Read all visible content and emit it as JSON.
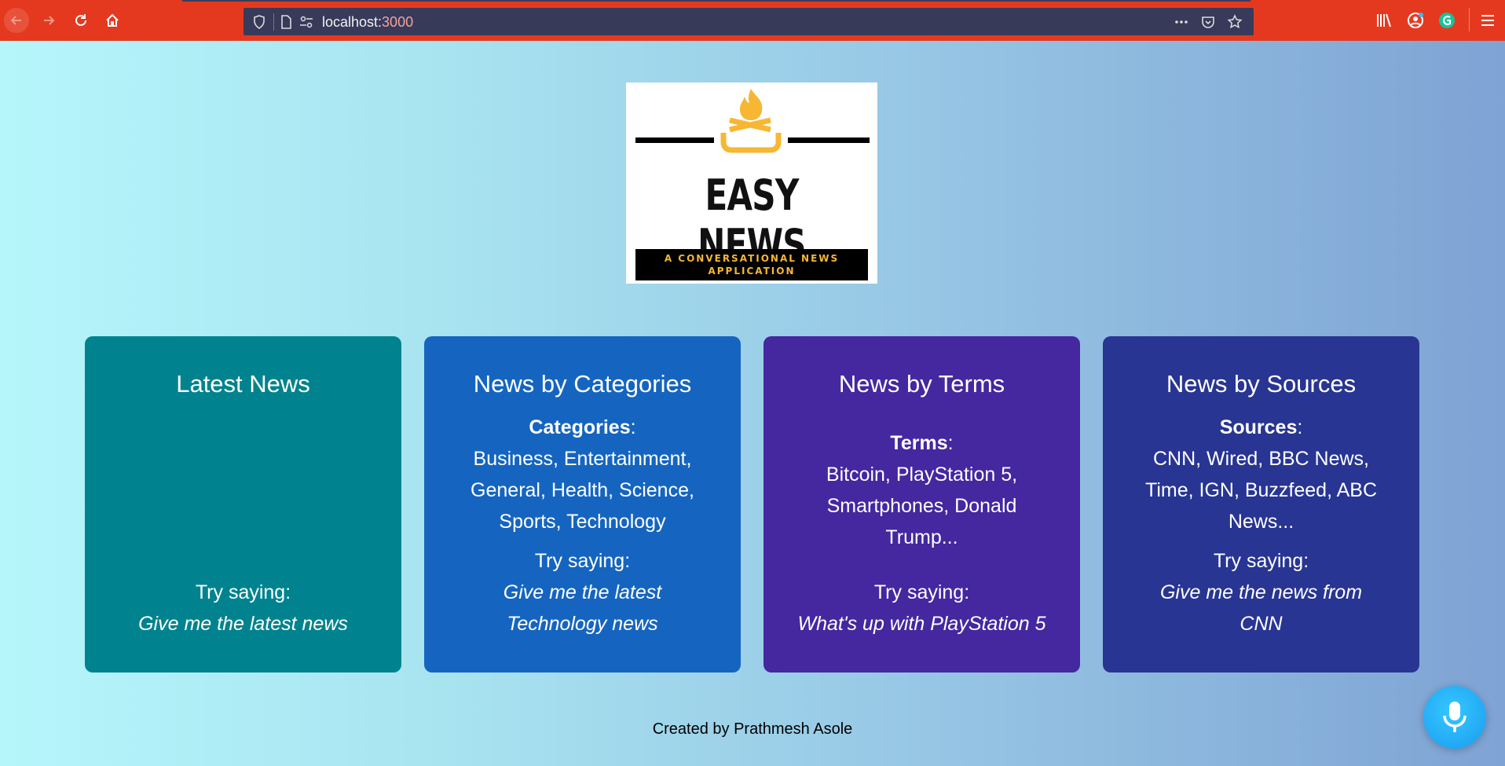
{
  "browser": {
    "url_host": "localhost:",
    "url_port": "3000"
  },
  "logo": {
    "title": "EASY NEWS",
    "subtitle": "A CONVERSATIONAL NEWS APPLICATION"
  },
  "cards": [
    {
      "title": "Latest News",
      "try_label": "Try saying:",
      "try_phrase": "Give me the latest news",
      "color": "#00838f"
    },
    {
      "title": "News by Categories",
      "info_label": "Categories",
      "info_colon": ":",
      "info_text": "Business, Entertainment, General, Health, Science, Sports, Technology",
      "try_label": "Try saying:",
      "try_phrase": "Give me the latest Technology news",
      "color": "#1565c0"
    },
    {
      "title": "News by Terms",
      "info_label": "Terms",
      "info_colon": ":",
      "info_text": "Bitcoin, PlayStation 5, Smartphones, Donald Trump...",
      "try_label": "Try saying:",
      "try_phrase": "What's up with PlayStation 5",
      "color": "#4527a0"
    },
    {
      "title": "News by Sources",
      "info_label": "Sources",
      "info_colon": ":",
      "info_text": "CNN, Wired, BBC News, Time, IGN, Buzzfeed, ABC News...",
      "try_label": "Try saying:",
      "try_phrase": "Give me the news from CNN",
      "color": "#283593"
    }
  ],
  "footer": {
    "text": "Created by Prathmesh Asole"
  },
  "icons": {
    "back": "back-arrow-icon",
    "forward": "forward-arrow-icon",
    "reload": "reload-icon",
    "home": "home-icon",
    "mic": "microphone-icon"
  }
}
